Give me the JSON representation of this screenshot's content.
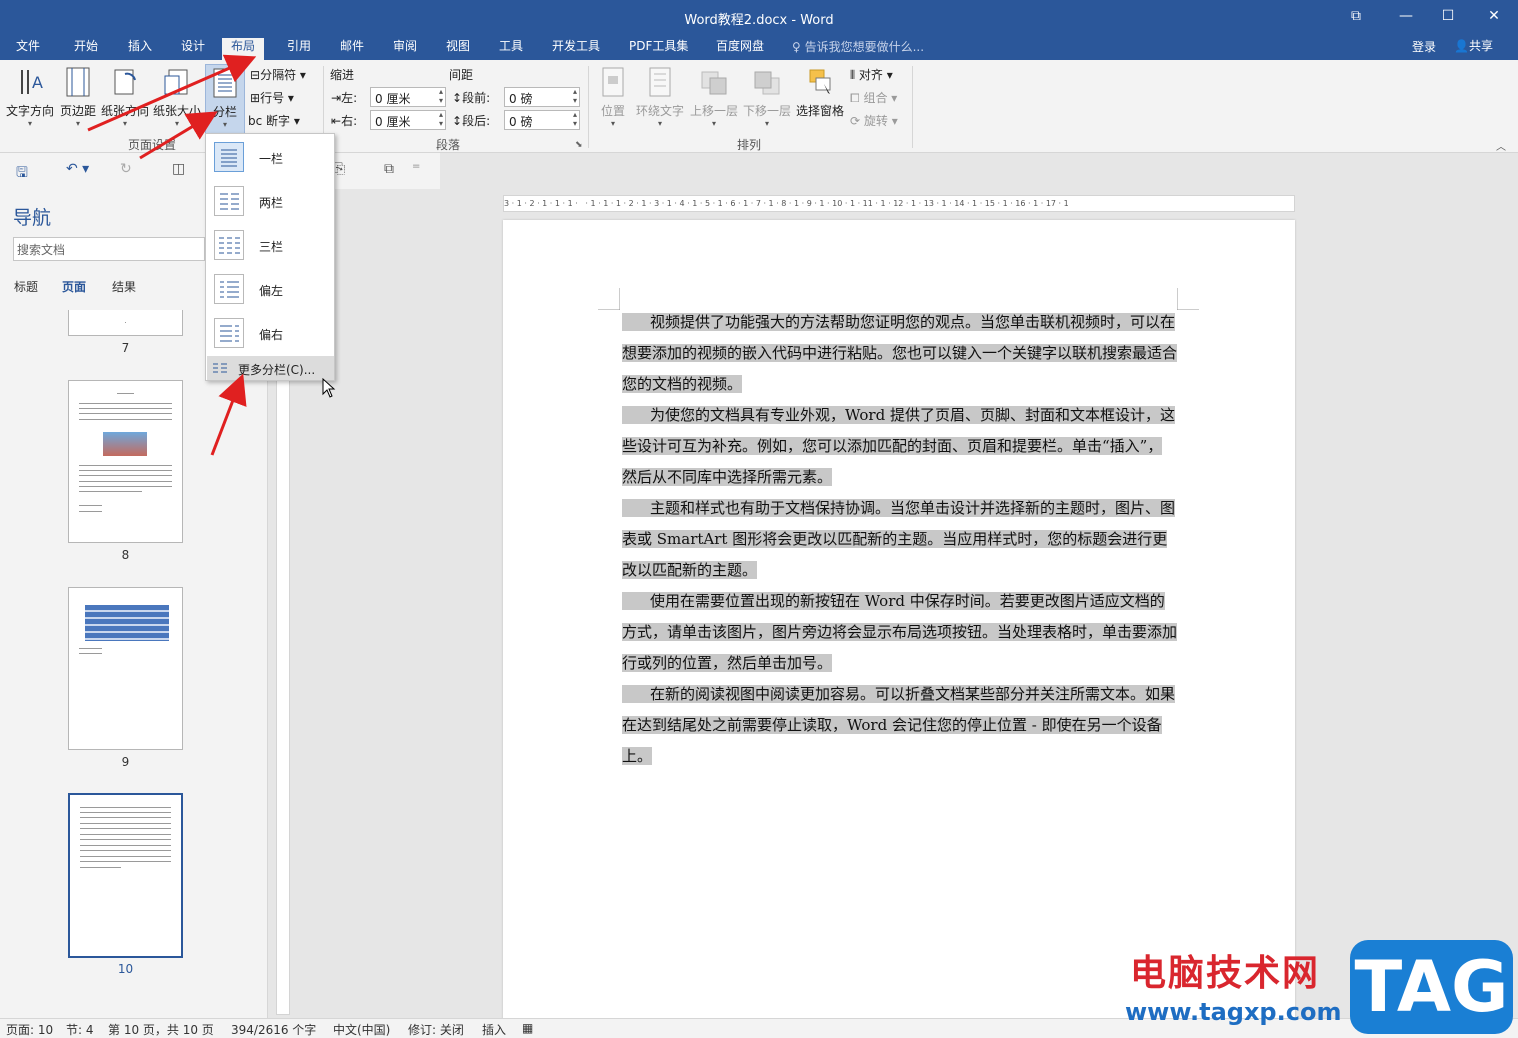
{
  "window": {
    "title": "Word教程2.docx - Word"
  },
  "menu": {
    "tabs": [
      "文件",
      "开始",
      "插入",
      "设计",
      "布局",
      "引用",
      "邮件",
      "审阅",
      "视图",
      "工具",
      "开发工具",
      "PDF工具集",
      "百度网盘"
    ],
    "active": "布局",
    "tell_me": "告诉我您想要做什么...",
    "login": "登录",
    "share": "共享"
  },
  "ribbon": {
    "page_setup": {
      "label": "页面设置",
      "text_direction": "文字方向",
      "margins": "页边距",
      "orientation": "纸张方向",
      "size": "纸张大小",
      "columns": "分栏",
      "breaks": "分隔符",
      "line_numbers": "行号",
      "hyphenation": "断字"
    },
    "paragraph": {
      "label": "段落",
      "indent": "缩进",
      "spacing": "间距",
      "left_label": "左:",
      "right_label": "右:",
      "left_value": "0 厘米",
      "right_value": "0 厘米",
      "before_label": "段前:",
      "after_label": "段后:",
      "before_value": "0 磅",
      "after_value": "0 磅"
    },
    "arrange": {
      "label": "排列",
      "position": "位置",
      "wrap": "环绕文字",
      "forward": "上移一层",
      "backward": "下移一层",
      "pane": "选择窗格",
      "align": "对齐",
      "group": "组合",
      "rotate": "旋转"
    }
  },
  "columns_menu": {
    "items": [
      "一栏",
      "两栏",
      "三栏",
      "偏左",
      "偏右"
    ],
    "more": "更多分栏(C)..."
  },
  "nav": {
    "title": "导航",
    "search_placeholder": "搜索文档",
    "tabs": [
      "标题",
      "页面",
      "结果"
    ],
    "active_tab": "页面",
    "pages": [
      "7",
      "8",
      "9",
      "10"
    ]
  },
  "ruler": {
    "text": "3 · 1 · 2 · 1 · 1 · 1 ·   · 1 · 1 · 1 · 2 · 1 · 3 · 1 · 4 · 1 · 5 · 1 · 6 · 1 · 7 · 1 · 8 · 1 · 9 · 1 · 10 · 1 · 11 · 1 · 12 · 1 · 13 · 1 · 14 · 1 · 15 · 1 · 16 · 1 · 17 · 1"
  },
  "document": {
    "paragraphs": [
      "视频提供了功能强大的方法帮助您证明您的观点。当您单击联机视频时，可以在想要添加的视频的嵌入代码中进行粘贴。您也可以键入一个关键字以联机搜索最适合您的文档的视频。",
      "为使您的文档具有专业外观，Word 提供了页眉、页脚、封面和文本框设计，这些设计可互为补充。例如，您可以添加匹配的封面、页眉和提要栏。单击“插入”，然后从不同库中选择所需元素。",
      "主题和样式也有助于文档保持协调。当您单击设计并选择新的主题时，图片、图表或 SmartArt 图形将会更改以匹配新的主题。当应用样式时，您的标题会进行更改以匹配新的主题。",
      "使用在需要位置出现的新按钮在 Word 中保存时间。若要更改图片适应文档的方式，请单击该图片，图片旁边将会显示布局选项按钮。当处理表格时，单击要添加行或列的位置，然后单击加号。",
      "在新的阅读视图中阅读更加容易。可以折叠文档某些部分并关注所需文本。如果在达到结尾处之前需要停止读取，Word 会记住您的停止位置 - 即使在另一个设备上。"
    ]
  },
  "status": {
    "page": "页面: 10",
    "section": "节: 4",
    "pages": "第 10 页，共 10 页",
    "words": "394/2616 个字",
    "lang": "中文(中国)",
    "track": "修订: 关闭",
    "insert": "插入"
  },
  "watermark": {
    "cn": "电脑技术网",
    "url": "www.tagxp.com",
    "tag": "TAG"
  },
  "colors": {
    "accent": "#2b579a",
    "highlight": "#c8c8c8",
    "arrow": "#e02020"
  }
}
